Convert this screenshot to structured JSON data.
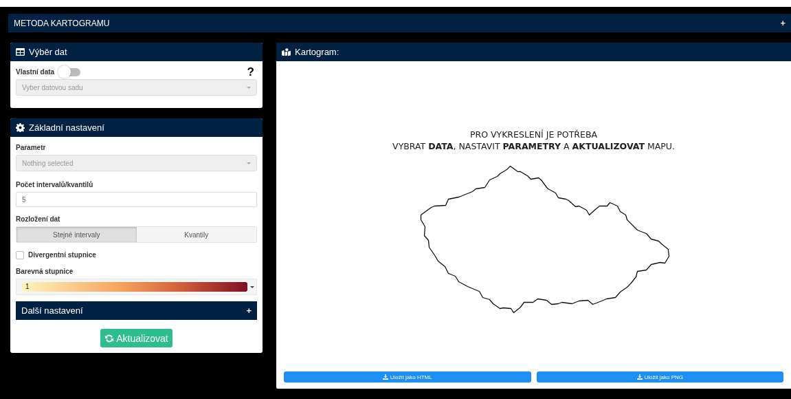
{
  "header": {
    "title": "METODA KARTOGRAMU",
    "toggle": "+"
  },
  "data_panel": {
    "title": "Výběr dat",
    "custom_data": {
      "label": "Vlastní data",
      "on": false
    },
    "help": "?",
    "dataset_select": {
      "placeholder": "Vyber datovou sadu",
      "disabled": true
    }
  },
  "settings_panel": {
    "title": "Základní nastavení",
    "parameter": {
      "label": "Parametr",
      "placeholder": "Nothing selected",
      "disabled": true
    },
    "intervals": {
      "label": "Počet intervalů/kvantilů",
      "value": "5"
    },
    "distribution": {
      "label": "Rozložení dat",
      "options": [
        {
          "label": "Stejné intervaly",
          "selected": true
        },
        {
          "label": "Kvantily",
          "selected": false
        }
      ]
    },
    "divergent": {
      "label": "Divergentní stupnice",
      "checked": false
    },
    "color_scale": {
      "label": "Barevná stupnice",
      "value": "1"
    },
    "more": {
      "title": "Další nastavení",
      "toggle": "+",
      "expanded": false
    },
    "update_button": "Aktualizovat"
  },
  "map_panel": {
    "title": "Kartogram:",
    "message": [
      "PRO VYKRESLENÍ JE POTŘEBA",
      "VYBRAT **DATA**, NASTAVIT **PARAMETRY** A **AKTUALIZOVAT** MAPU."
    ],
    "buttons": [
      "Uložit jako HTML",
      "Uložit jako PNG"
    ]
  }
}
